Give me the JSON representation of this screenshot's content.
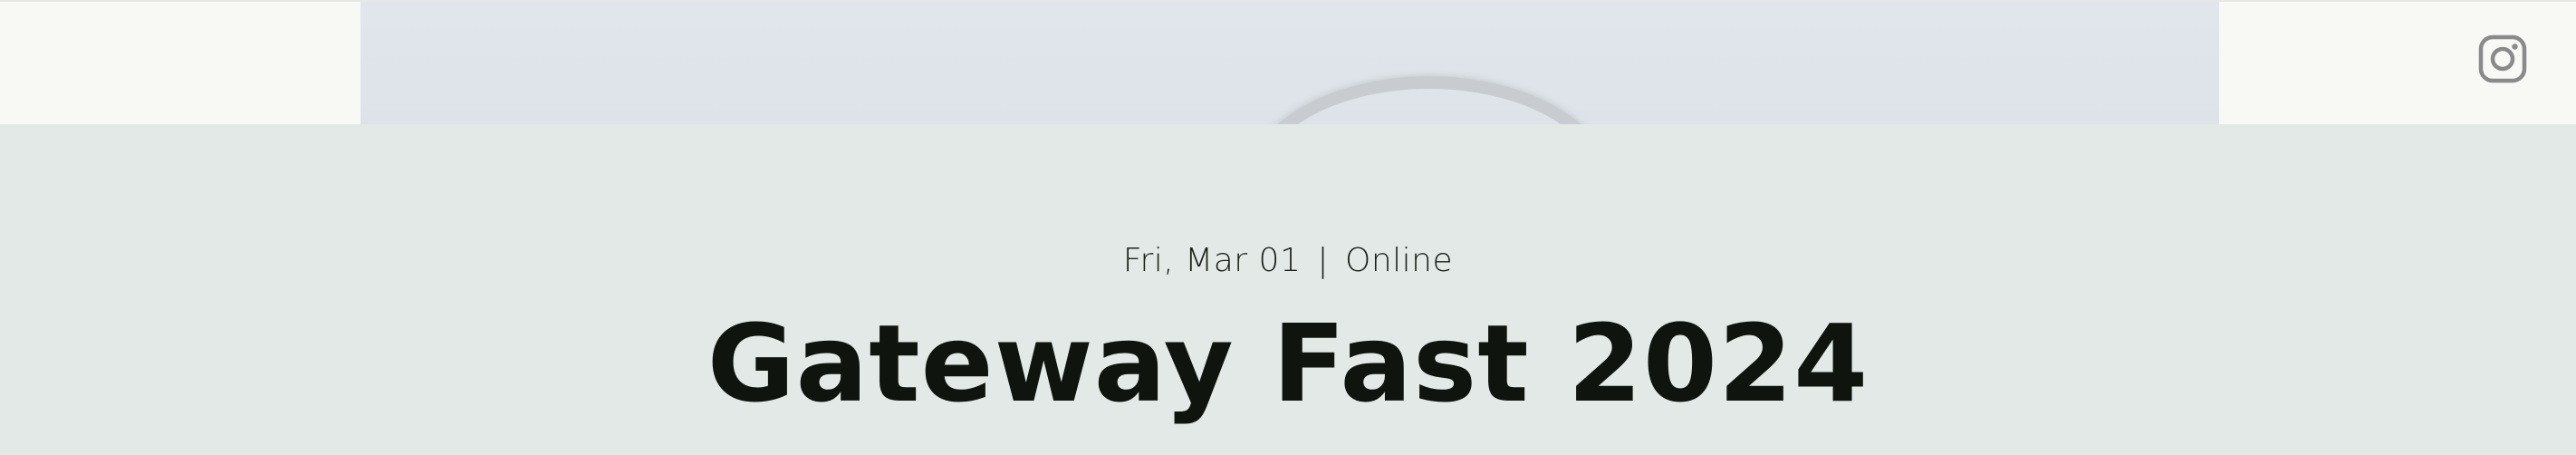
{
  "event": {
    "date": "Fri, Mar 01",
    "separator": "|",
    "location": "Online",
    "title": "Gateway Fast 2024"
  },
  "header": {
    "social_icon": "instagram-icon"
  },
  "colors": {
    "header_bg": "#f8f9f5",
    "content_bg": "#e3e9e6",
    "title_color": "#0f140e",
    "icon_color": "#8a8a8a"
  }
}
